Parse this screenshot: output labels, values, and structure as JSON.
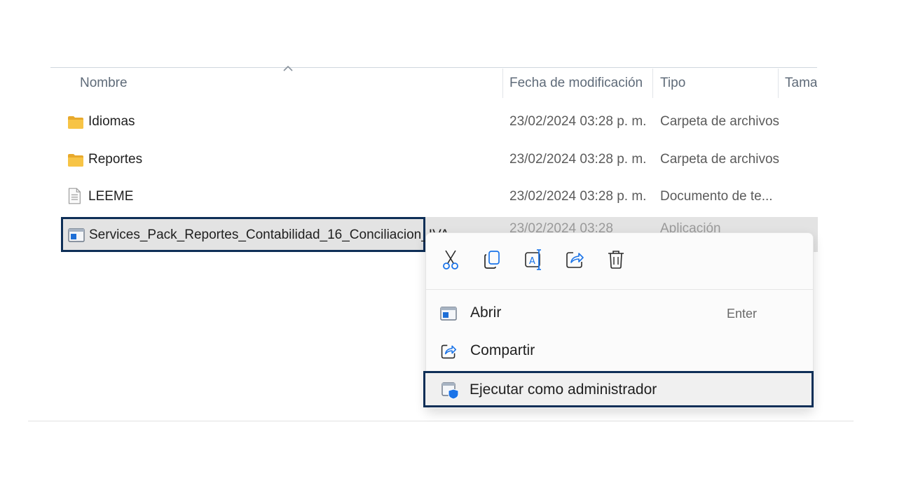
{
  "columns": {
    "name": "Nombre",
    "date": "Fecha de modificación",
    "type": "Tipo",
    "size": "Tamaí"
  },
  "files": [
    {
      "name": "Idiomas",
      "date": "23/02/2024 03:28 p. m.",
      "type": "Carpeta de archivos",
      "icon": "folder-icon"
    },
    {
      "name": "Reportes",
      "date": "23/02/2024 03:28 p. m.",
      "type": "Carpeta de archivos",
      "icon": "folder-icon"
    },
    {
      "name": "LEEME",
      "date": "23/02/2024 03:28 p. m.",
      "type": "Documento de te...",
      "icon": "text-document-icon"
    },
    {
      "name": "Services_Pack_Reportes_Contabilidad_16_Conciliacion_IVA",
      "date": "23/02/2024 03:28",
      "type": "Aplicación",
      "icon": "application-icon",
      "selected": true
    }
  ],
  "context_menu": {
    "quick_actions": [
      {
        "name": "cut",
        "icon": "scissors-icon"
      },
      {
        "name": "copy",
        "icon": "copy-icon"
      },
      {
        "name": "rename",
        "icon": "rename-icon"
      },
      {
        "name": "share",
        "icon": "share-icon"
      },
      {
        "name": "delete",
        "icon": "trash-icon"
      }
    ],
    "items": [
      {
        "label": "Abrir",
        "shortcut": "Enter",
        "icon": "application-icon"
      },
      {
        "label": "Compartir",
        "icon": "share-icon"
      },
      {
        "label": "Ejecutar como administrador",
        "icon": "shield-app-icon"
      }
    ]
  },
  "colors": {
    "highlight_border": "#0e2f57",
    "folder": "#f2b93b",
    "selection": "#e3e3e3",
    "accent": "#1a73e8"
  }
}
